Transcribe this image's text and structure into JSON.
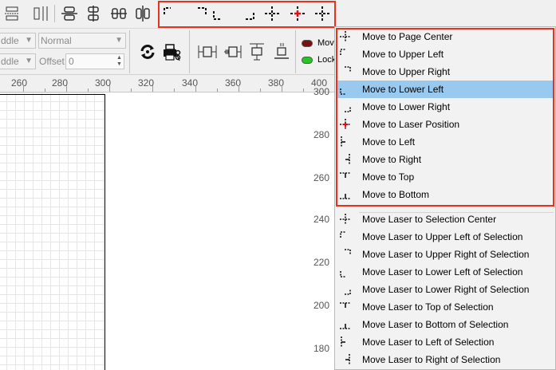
{
  "toolbar2": {
    "combo1": "ddle",
    "combo2": "ddle",
    "combo_normal": "Normal",
    "offset_label": "Offset",
    "offset_value": "0",
    "switch_move": "Mov",
    "switch_lock": "Lock"
  },
  "ruler": {
    "h": [
      "260",
      "280",
      "300",
      "320",
      "340",
      "360",
      "380",
      "400"
    ],
    "v": [
      "300",
      "280",
      "260",
      "240",
      "220",
      "200",
      "180"
    ]
  },
  "menu": {
    "group1": [
      {
        "label": "Move to Page Center",
        "icon": "align-center-icon"
      },
      {
        "label": "Move to Upper Left",
        "icon": "align-upper-left-icon"
      },
      {
        "label": "Move to Upper Right",
        "icon": "align-upper-right-icon"
      },
      {
        "label": "Move to Lower Left",
        "icon": "align-lower-left-icon",
        "selected": true
      },
      {
        "label": "Move to Lower Right",
        "icon": "align-lower-right-icon"
      },
      {
        "label": "Move to Laser Position",
        "icon": "laser-position-icon"
      },
      {
        "label": "Move to Left",
        "icon": "align-left-icon"
      },
      {
        "label": "Move to Right",
        "icon": "align-right-icon"
      },
      {
        "label": "Move to Top",
        "icon": "align-top-icon"
      },
      {
        "label": "Move to Bottom",
        "icon": "align-bottom-icon"
      }
    ],
    "group2": [
      {
        "label": "Move Laser to Selection Center",
        "icon": "align-center-icon"
      },
      {
        "label": "Move Laser to Upper Left of Selection",
        "icon": "align-upper-left-icon"
      },
      {
        "label": "Move Laser to Upper Right of Selection",
        "icon": "align-upper-right-icon"
      },
      {
        "label": "Move Laser to Lower Left of Selection",
        "icon": "align-lower-left-icon"
      },
      {
        "label": "Move Laser to Lower Right of Selection",
        "icon": "align-lower-right-icon"
      },
      {
        "label": "Move Laser to Top of Selection",
        "icon": "align-top-icon"
      },
      {
        "label": "Move Laser to Bottom of Selection",
        "icon": "align-bottom-icon"
      },
      {
        "label": "Move Laser to Left of Selection",
        "icon": "align-left-icon"
      },
      {
        "label": "Move Laser to Right of Selection",
        "icon": "align-right-icon"
      }
    ]
  },
  "colors": {
    "highlight": "#e8321e",
    "selected_row": "#99c9ef",
    "laser_dot": "#e01010"
  }
}
